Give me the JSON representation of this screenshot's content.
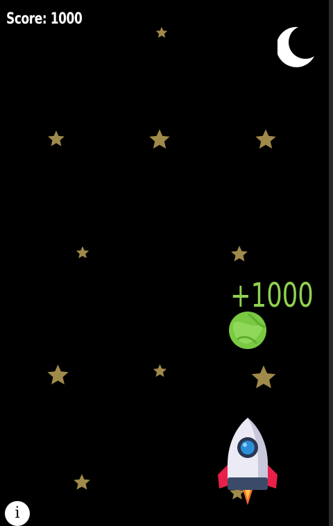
{
  "hud": {
    "score_label": "Score: 1000",
    "bonus_label": "+1000",
    "info_label": "i"
  },
  "icons": {
    "moon": "crescent-moon-icon",
    "star": "star-icon",
    "coin": "green-planet-coin-icon",
    "rocket": "rocket-ship-icon",
    "info": "info-icon"
  },
  "colors": {
    "background": "#000000",
    "star": "#a08a4a",
    "bonus_text": "#8fd14f",
    "coin": "#7ac943",
    "rocket_body": "#e8e8f0",
    "rocket_fins": "#e8204a",
    "rocket_window": "#2a8fd8"
  }
}
